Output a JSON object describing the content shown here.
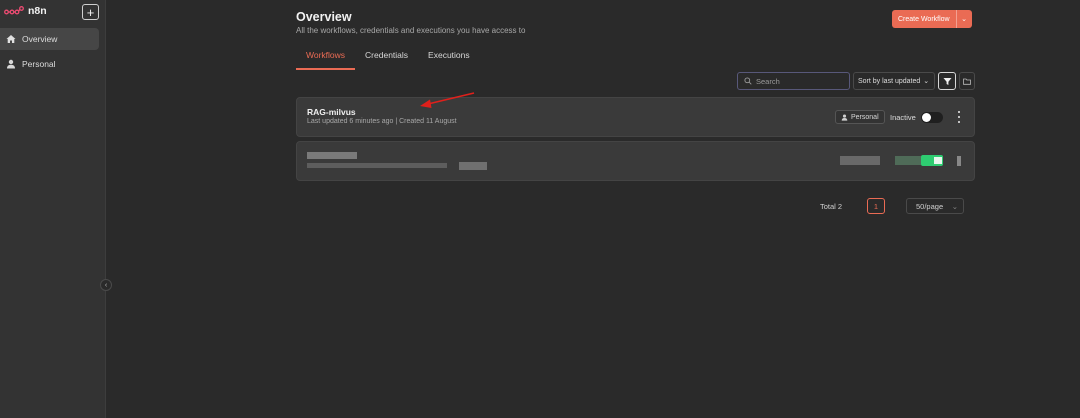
{
  "sidebar": {
    "brand": "n8n",
    "add_label": "+",
    "items": [
      {
        "label": "Overview",
        "active": true,
        "icon": "home-icon"
      },
      {
        "label": "Personal",
        "active": false,
        "icon": "user-icon"
      }
    ],
    "collapse_glyph": "‹"
  },
  "header": {
    "title": "Overview",
    "subtitle": "All the workflows, credentials and executions you have access to",
    "create_label": "Create Workflow",
    "create_dropdown_glyph": "⌄"
  },
  "tabs": [
    {
      "label": "Workflows",
      "active": true
    },
    {
      "label": "Credentials",
      "active": false
    },
    {
      "label": "Executions",
      "active": false
    }
  ],
  "toolbar": {
    "search_placeholder": "Search",
    "sort_label": "Sort by last updated",
    "sort_glyph": "⌄"
  },
  "workflows": [
    {
      "title": "RAG-milvus",
      "meta": "Last updated 6 minutes ago | Created 11 August",
      "owner": "Personal",
      "status": "Inactive",
      "active": false
    }
  ],
  "pagination": {
    "total_label": "Total 2",
    "current_page": "1",
    "per_page": "50/page",
    "per_page_glyph": "⌄"
  },
  "colors": {
    "accent": "#ea6b54",
    "brand": "#ea4b71",
    "active_toggle": "#2ecc71"
  }
}
